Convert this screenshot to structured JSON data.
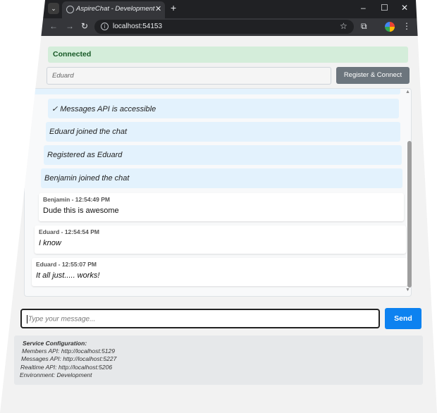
{
  "browser": {
    "tab_title": "AspireChat - Development",
    "tab_close": "✕",
    "new_tab": "+",
    "tab_strip_icon": "chevron-down-icon",
    "url": "localhost:54153",
    "back_icon": "←",
    "forward_icon": "→",
    "reload_icon": "↻",
    "star_icon": "☆",
    "extensions_icon": "⧉",
    "menu_icon": "⋮",
    "minimize": "–",
    "maximize": "☐",
    "close": "✕"
  },
  "status": {
    "text": "Connected",
    "color": "#155724",
    "bg": "#d4edda"
  },
  "register": {
    "name_value": "Eduard",
    "button_label": "Register & Connect",
    "button_color": "#6c757d"
  },
  "messages": {
    "system": [
      {
        "text": "✓ Messages API is accessible"
      },
      {
        "text": "Eduard joined the chat"
      },
      {
        "text": "Registered as Eduard"
      },
      {
        "text": "Benjamin joined the chat"
      }
    ],
    "chat": [
      {
        "meta": "Benjamin - 12:54:49 PM",
        "text": "Dude this is awesome"
      },
      {
        "meta": "Eduard - 12:54:54 PM",
        "text": "I know"
      },
      {
        "meta": "Eduard - 12:55:07 PM",
        "text": "It all just..... works!"
      }
    ]
  },
  "composer": {
    "placeholder": "Type your message...",
    "send_label": "Send",
    "send_color": "#0d82f0"
  },
  "config": {
    "title": "Service Configuration:",
    "members": "Members API: http://localhost:5129",
    "messages": "Messages API: http://localhost:5227",
    "realtime": "Realtime API: http://localhost:5206",
    "environment": "Environment: Development"
  }
}
